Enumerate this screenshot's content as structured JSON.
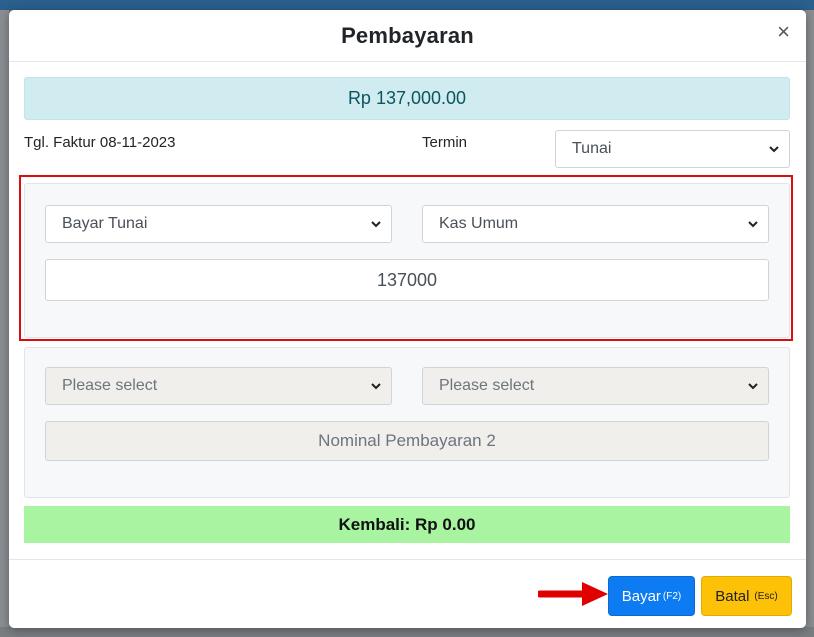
{
  "modal": {
    "title": "Pembayaran",
    "close_symbol": "×"
  },
  "total": "Rp 137,000.00",
  "invoice_date": "Tgl. Faktur 08-11-2023",
  "termin": {
    "label": "Termin",
    "value": "Tunai"
  },
  "payment1": {
    "method": "Bayar Tunai",
    "account": "Kas Umum",
    "amount": "137000"
  },
  "payment2": {
    "method_placeholder": "Please select",
    "account_placeholder": "Please select",
    "amount_placeholder": "Nominal Pembayaran 2"
  },
  "change": "Kembali: Rp 0.00",
  "buttons": {
    "pay_label": "Bayar",
    "pay_key": "(F2)",
    "cancel_label": "Batal",
    "cancel_key": "(Esc)"
  },
  "colors": {
    "highlight_border": "#d90f0f",
    "arrow": "#e00000",
    "pay_button": "#0d7cf2",
    "cancel_button": "#fdc107",
    "change_bg": "#a9f4a0",
    "total_bg": "#d1ecf1"
  },
  "icons": {
    "close": "close-icon",
    "select_chevron": "chevron-down-icon",
    "annotation_arrow": "arrow-right-icon"
  }
}
